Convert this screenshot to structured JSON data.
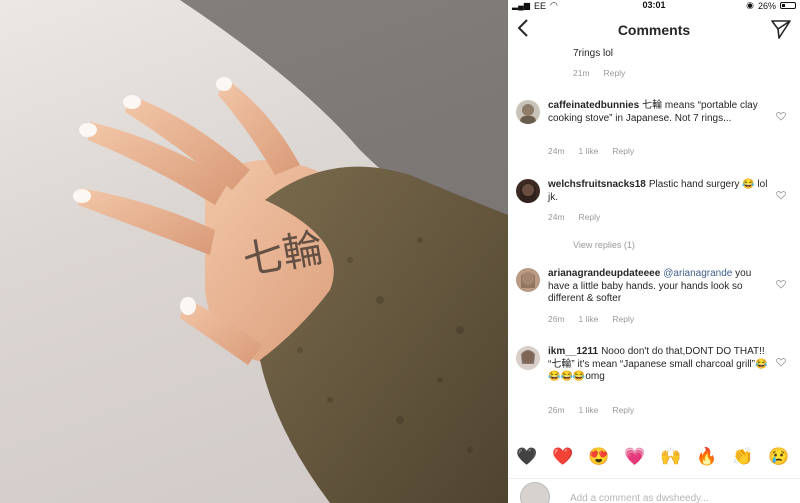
{
  "status": {
    "carrier": "EE",
    "time": "03:01",
    "battery": "26%"
  },
  "header": {
    "title": "Comments"
  },
  "comments": [
    {
      "user": "",
      "text": "7rings lol",
      "time": "21m",
      "likes": "",
      "reply": "Reply"
    },
    {
      "user": "caffeinatedbunnies",
      "text": "七輪 means “portable clay cooking stove” in Japanese. Not 7 rings...",
      "time": "24m",
      "likes": "1 like",
      "reply": "Reply"
    },
    {
      "user": "welchsfruitsnacks18",
      "text": "Plastic hand surgery 😂 lol jk.",
      "time": "24m",
      "likes": "",
      "reply": "Reply",
      "view_replies": "View replies (1)"
    },
    {
      "user": "arianagrandeupdateeee",
      "mention": "@arianagrande",
      "text": "you have a little baby hands. your hands look so different & softer",
      "time": "26m",
      "likes": "1 like",
      "reply": "Reply"
    },
    {
      "user": "ikm__1211",
      "text": "Nooo don't do that,DONT DO THAT!! “七輪” it's mean “Japanese small charcoal grill”😂😂😂😂omg",
      "time": "26m",
      "likes": "1 like",
      "reply": "Reply"
    }
  ],
  "emojis": [
    "🖤",
    "❤️",
    "😍",
    "💗",
    "🙌",
    "🔥",
    "👏",
    "😢"
  ],
  "add_comment": {
    "placeholder": "Add a comment as dwsheedy..."
  },
  "photo": {
    "tattoo_text": "七輪"
  }
}
